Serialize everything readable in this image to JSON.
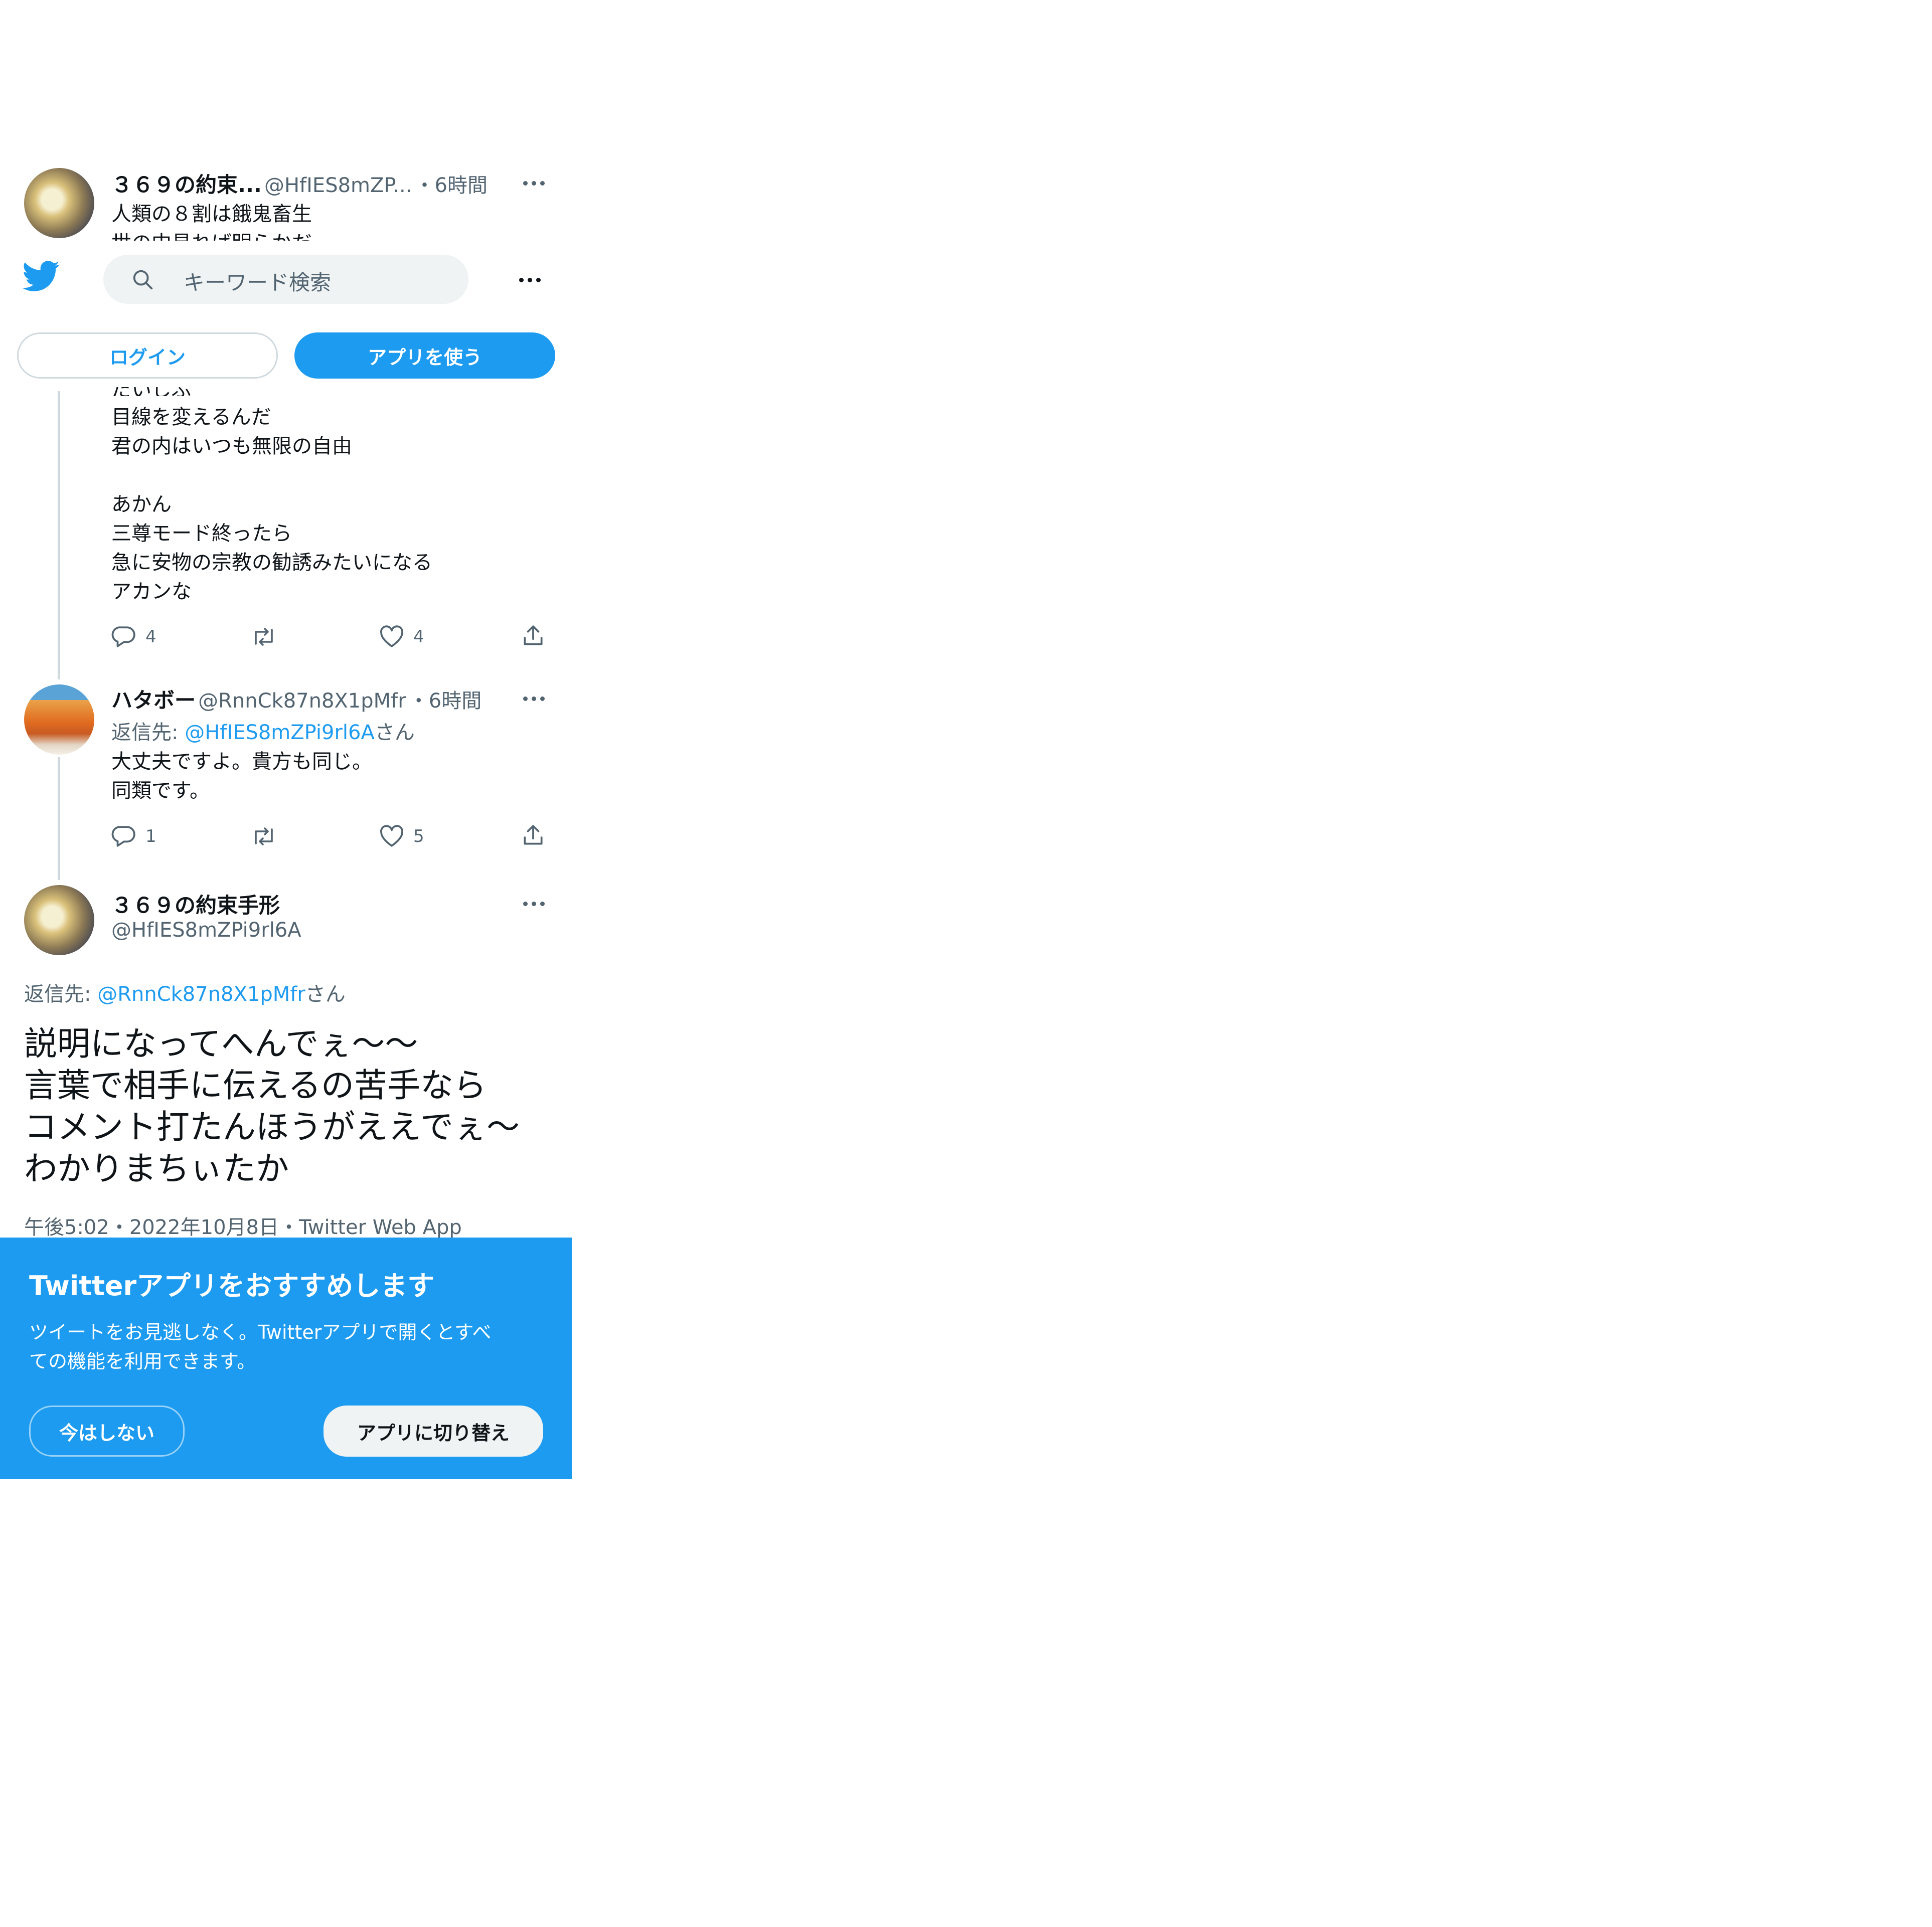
{
  "header": {
    "search_placeholder": "キーワード検索",
    "login_label": "ログイン",
    "use_app_label": "アプリを使う"
  },
  "tweet1": {
    "display_name": "３６９の約束...",
    "handle": "@HfIES8mZP...",
    "time": "・6時間",
    "line1": "人類の８割は餓鬼畜生",
    "line2_partial": "世の中見れば明らかだ",
    "hidden_partial": "だいじぶ",
    "lines": [
      "目線を変えるんだ",
      "君の内はいつも無限の自由",
      "",
      "あかん",
      "三尊モード終ったら",
      "急に安物の宗教の勧誘みたいになる",
      "アカンな"
    ],
    "replies": "4",
    "likes": "4"
  },
  "tweet2": {
    "display_name": "ハタボー",
    "handle": "@RnnCk87n8X1pMfr",
    "time": "・6時間",
    "reply_prefix": "返信先: ",
    "reply_to": "@HfIES8mZPi9rl6A",
    "reply_suffix": "さん",
    "lines": [
      "大丈夫ですよ。貴方も同じ。",
      "同類です。"
    ],
    "replies": "1",
    "likes": "5"
  },
  "main_tweet": {
    "display_name": "３６９の約束手形",
    "handle": "@HfIES8mZPi9rl6A",
    "reply_prefix": "返信先: ",
    "reply_to": "@RnnCk87n8X1pMfr",
    "reply_suffix": "さん",
    "lines": [
      "説明になってへんでぇ～～",
      "言葉で相手に伝えるの苦手なら",
      "コメント打たんほうがええでぇ～",
      "わかりまちぃたか"
    ],
    "meta": "午後5:02・2022年10月8日・Twitter Web App"
  },
  "banner": {
    "title": "Twitterアプリをおすすめします",
    "body_line1": "ツイートをお見逃しなく。Twitterアプリで開くとすべ",
    "body_line2": "ての機能を利用できます。",
    "dismiss_label": "今はしない",
    "switch_label": "アプリに切り替え"
  },
  "colors": {
    "accent": "#1d9bf0",
    "text": "#0f1419",
    "muted": "#536471"
  }
}
